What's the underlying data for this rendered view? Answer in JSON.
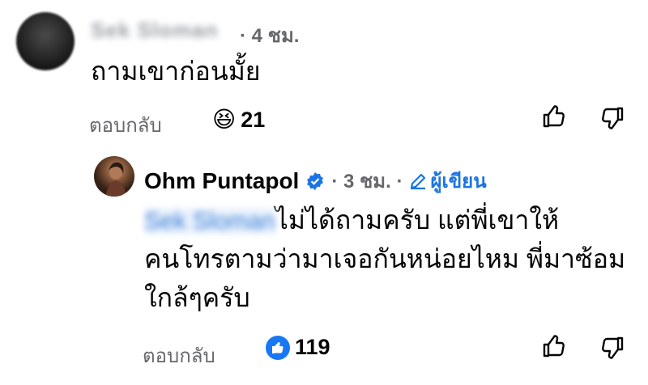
{
  "comment1": {
    "author_name": "Sek Sloman",
    "time": "· 4 ชม.",
    "text": "ถามเขาก่อนมั้ย",
    "reply_label": "ตอบกลับ",
    "reaction_emoji": "😆",
    "reaction_count": "21"
  },
  "comment2": {
    "author_name": "Ohm Puntapol",
    "time": "· 3 ชม. ·",
    "author_tag": "ผู้เขียน",
    "mention": "Sek Sloman",
    "text_line1": "ไม่ได้ถามครับ แต่พี่เขาให้",
    "text_line2": "คนโทรตามว่ามาเจอกันหน่อยไหม พี่มาซ้อม",
    "text_line3": "ใกล้ๆครับ",
    "reply_label": "ตอบกลับ",
    "reaction_count": "119"
  },
  "colors": {
    "accent": "#1b74e4",
    "meta": "#65676b",
    "like_badge": "#1877f2"
  }
}
